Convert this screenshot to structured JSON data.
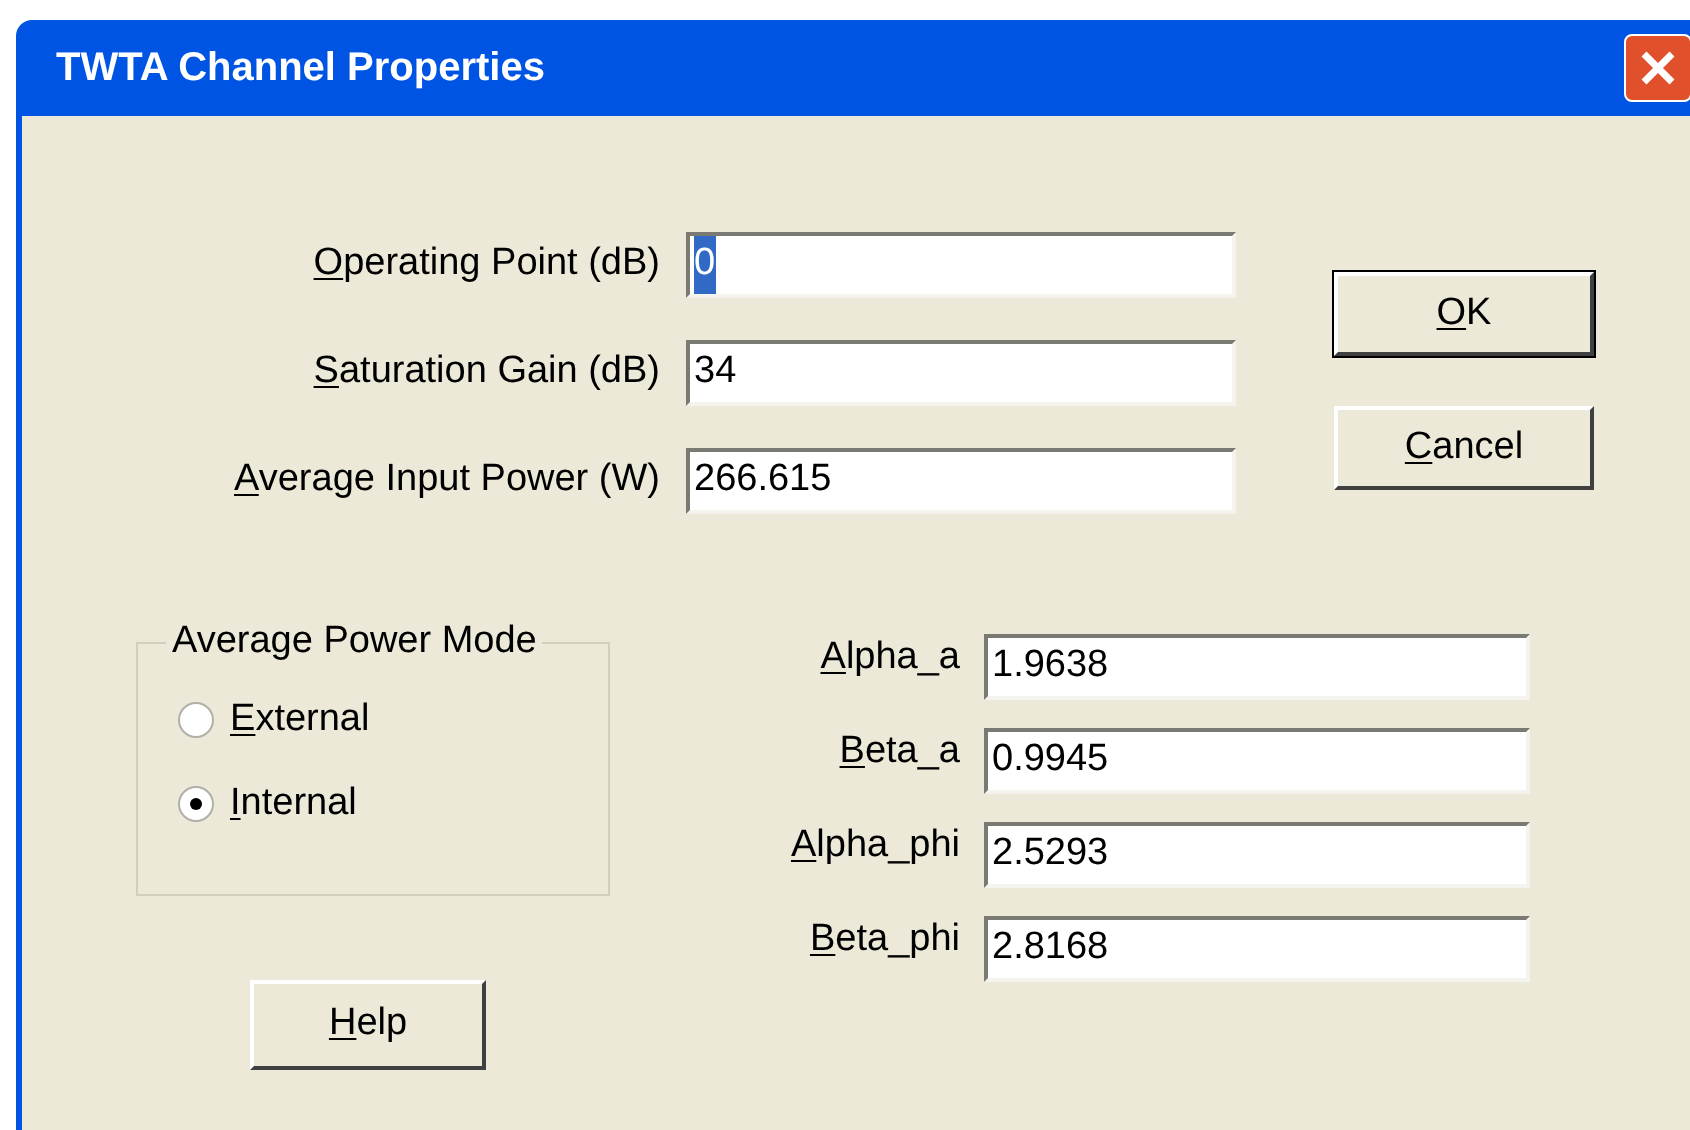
{
  "window": {
    "title": "TWTA Channel Properties"
  },
  "top_fields": [
    {
      "label": "Operating Point (dB)",
      "access_key_underlined": true,
      "value": "0",
      "selected": true
    },
    {
      "label": "Saturation Gain (dB)",
      "access_key_underlined": true,
      "value": "34",
      "selected": false
    },
    {
      "label": "Average Input Power (W)",
      "access_key_underlined": true,
      "value": "266.615",
      "selected": false
    }
  ],
  "buttons": [
    {
      "label": "OK",
      "access_key_underlined": true,
      "default": true
    },
    {
      "label": "Cancel",
      "access_key_underlined": true,
      "default": false
    }
  ],
  "power_mode": {
    "title": "Average Power Mode",
    "options": [
      {
        "label": "External",
        "access_key_underlined": true,
        "selected": false
      },
      {
        "label": "Internal",
        "access_key_underlined": true,
        "selected": true
      }
    ]
  },
  "help_button": {
    "label": "Help",
    "access_key_underlined": true
  },
  "parameters": [
    {
      "label": "Alpha_a",
      "access_key_underlined": true,
      "value": "1.9638"
    },
    {
      "label": "Beta_a",
      "access_key_underlined": true,
      "value": "0.9945"
    },
    {
      "label": "Alpha_phi",
      "access_key_underlined": true,
      "value": "2.5293"
    },
    {
      "label": "Beta_phi",
      "access_key_underlined": true,
      "value": "2.8168"
    }
  ]
}
